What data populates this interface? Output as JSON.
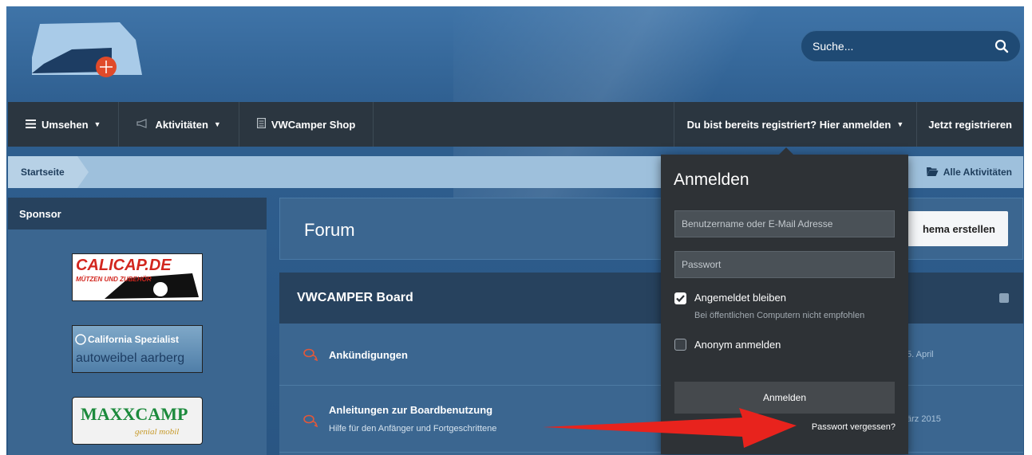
{
  "header": {
    "search_placeholder": "Suche..."
  },
  "nav": {
    "browse": "Umsehen",
    "activities": "Aktivitäten",
    "shop": "VWCamper Shop",
    "login_prompt": "Du bist bereits registriert? Hier anmelden",
    "register": "Jetzt registrieren"
  },
  "breadcrumb": {
    "home": "Startseite",
    "all_activities": "Alle Aktivitäten"
  },
  "sidebar": {
    "title": "Sponsor",
    "sponsors": [
      {
        "line1": "CALICAP.DE",
        "line2": "MÜTZEN UND ZUBEHÖR"
      },
      {
        "line1": "California Spezialist",
        "line2": "autoweibel aarberg"
      },
      {
        "line1": "MAXXCAMP",
        "line2": "genial mobil"
      }
    ]
  },
  "forum": {
    "title": "Forum",
    "new_topic_button": "hema erstellen"
  },
  "board": {
    "title": "VWCAMPER Board",
    "rows": [
      {
        "title": "Ankündigungen",
        "desc": "",
        "date": "5. April"
      },
      {
        "title": "Anleitungen zur Boardbenutzung",
        "desc": "Hilfe für den Anfänger und Fortgeschrittene",
        "date": "ärz 2015"
      }
    ]
  },
  "login_popup": {
    "title": "Anmelden",
    "username_placeholder": "Benutzername oder E-Mail Adresse",
    "password_placeholder": "Passwort",
    "remember_label": "Angemeldet bleiben",
    "remember_hint": "Bei öffentlichen Computern nicht empfohlen",
    "remember_checked": true,
    "anonymous_label": "Anonym anmelden",
    "anonymous_checked": false,
    "submit": "Anmelden",
    "forgot": "Passwort vergessen?"
  },
  "colors": {
    "navbar": "#2b3640",
    "page_bg": "#2f5f90",
    "popup_bg": "#2e3236",
    "annotation_arrow": "#e8231d"
  }
}
